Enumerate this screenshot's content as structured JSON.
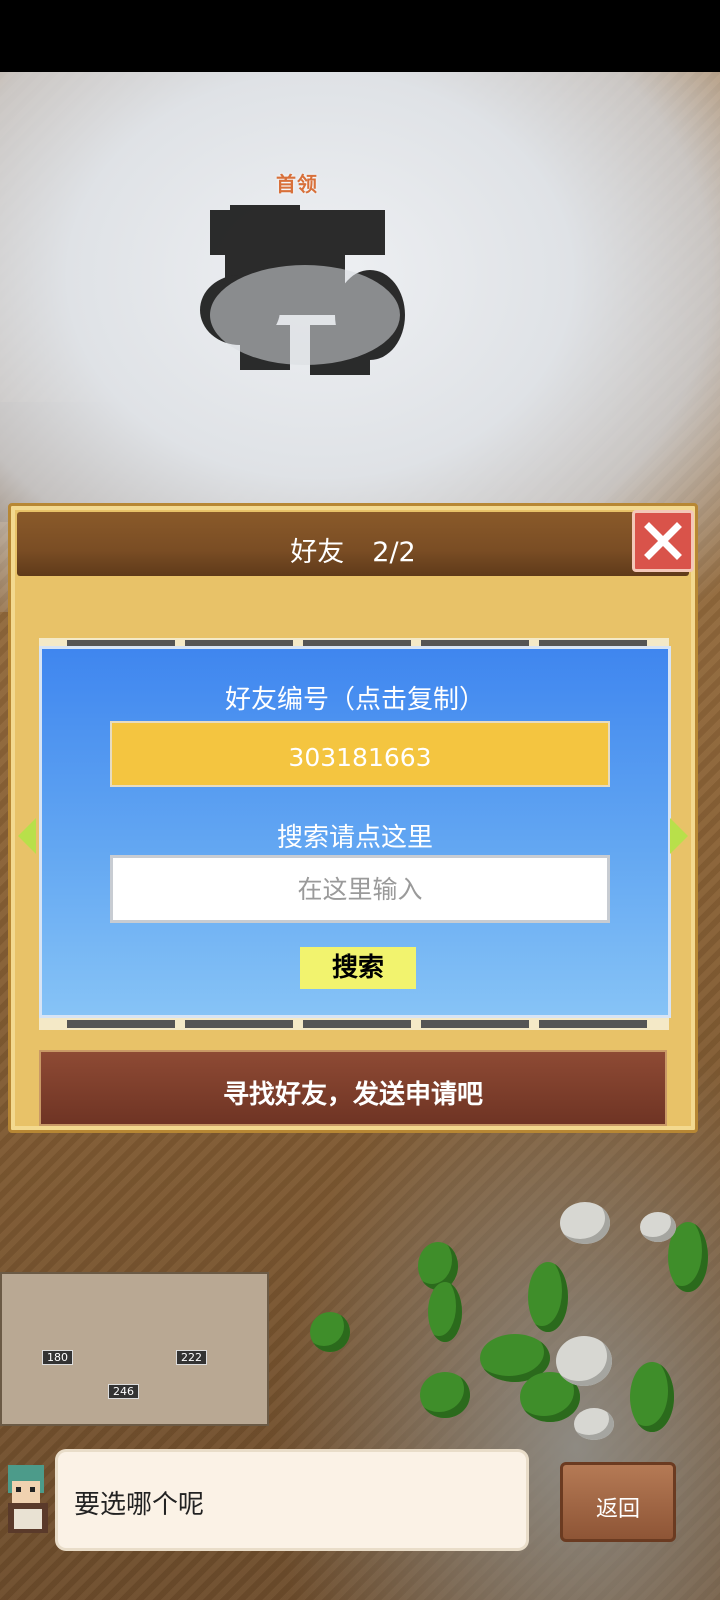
{
  "scene": {
    "boss_label": "首领"
  },
  "dialog": {
    "title": "好友",
    "page_indicator": "2/2",
    "friend_id_label": "好友编号（点击复制）",
    "friend_id_value": "303181663",
    "search_label": "搜索请点这里",
    "search_placeholder": "在这里输入",
    "search_button": "搜索",
    "find_friends_text": "寻找好友，发送申请吧"
  },
  "footer": {
    "speech_text": "要选哪个呢",
    "back_button": "返回"
  },
  "buildings": {
    "labels": [
      "180",
      "222",
      "246"
    ]
  },
  "colors": {
    "panel_blue": "#3f86ef",
    "id_box_yellow": "#f4c540",
    "search_button_yellow": "#f2f36e",
    "close_red": "#d9534a",
    "header_brown": "#7a4d24"
  }
}
